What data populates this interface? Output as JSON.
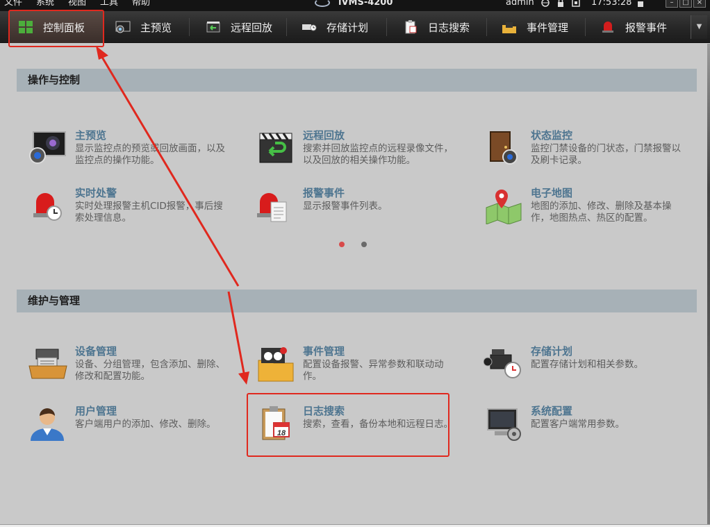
{
  "menubar": {
    "items": [
      "文件",
      "系统",
      "视图",
      "工具",
      "帮助"
    ],
    "app_title": "iVMS-4200",
    "user": "admin",
    "time": "17:53:28"
  },
  "toolbar": {
    "tabs": [
      {
        "label": "控制面板",
        "icon": "control-panel-icon"
      },
      {
        "label": "主预览",
        "icon": "main-preview-icon"
      },
      {
        "label": "远程回放",
        "icon": "remote-playback-icon"
      },
      {
        "label": "存储计划",
        "icon": "storage-plan-icon"
      },
      {
        "label": "日志搜索",
        "icon": "log-search-icon"
      },
      {
        "label": "事件管理",
        "icon": "event-management-icon"
      },
      {
        "label": "报警事件",
        "icon": "alarm-event-icon"
      }
    ],
    "active_tab": "控制面板"
  },
  "sections": {
    "operation": {
      "title": "操作与控制",
      "items": [
        {
          "title": "主预览",
          "desc": "显示监控点的预览或回放画面，以及监控点的操作功能。",
          "icon": "monitor-camera-icon"
        },
        {
          "title": "远程回放",
          "desc": "搜索并回放监控点的远程录像文件，以及回放的相关操作功能。",
          "icon": "clapperboard-icon"
        },
        {
          "title": "状态监控",
          "desc": "监控门禁设备的门状态，门禁报警以及刷卡记录。",
          "icon": "door-monitor-icon"
        },
        {
          "title": "实时处警",
          "desc": "实时处理报警主机CID报警，事后搜索处理信息。",
          "icon": "alarm-light-clock-icon"
        },
        {
          "title": "报警事件",
          "desc": "显示报警事件列表。",
          "icon": "alarm-light-list-icon"
        },
        {
          "title": "电子地图",
          "desc": "地图的添加、修改、删除及基本操作，地图热点、热区的配置。",
          "icon": "map-pin-icon"
        }
      ]
    },
    "maintenance": {
      "title": "维护与管理",
      "items": [
        {
          "title": "设备管理",
          "desc": "设备、分组管理，包含添加、删除、修改和配置功能。",
          "icon": "device-tray-icon"
        },
        {
          "title": "事件管理",
          "desc": "配置设备报警、异常参数和联动动作。",
          "icon": "folder-event-icon"
        },
        {
          "title": "存储计划",
          "desc": "配置存储计划和相关参数。",
          "icon": "camcorder-clock-icon"
        },
        {
          "title": "用户管理",
          "desc": "客户端用户的添加、修改、删除。",
          "icon": "user-avatar-icon"
        },
        {
          "title": "日志搜索",
          "desc": "搜索，查看，备份本地和远程日志。",
          "icon": "clipboard-calendar-icon"
        },
        {
          "title": "系统配置",
          "desc": "配置客户端常用参数。",
          "icon": "computer-gear-icon"
        }
      ]
    }
  },
  "pager": {
    "pages": 2,
    "current": 1
  },
  "colors": {
    "accent_title": "#4e7590",
    "annotation": "#e0281e",
    "section_header": "#a7b1b7"
  }
}
